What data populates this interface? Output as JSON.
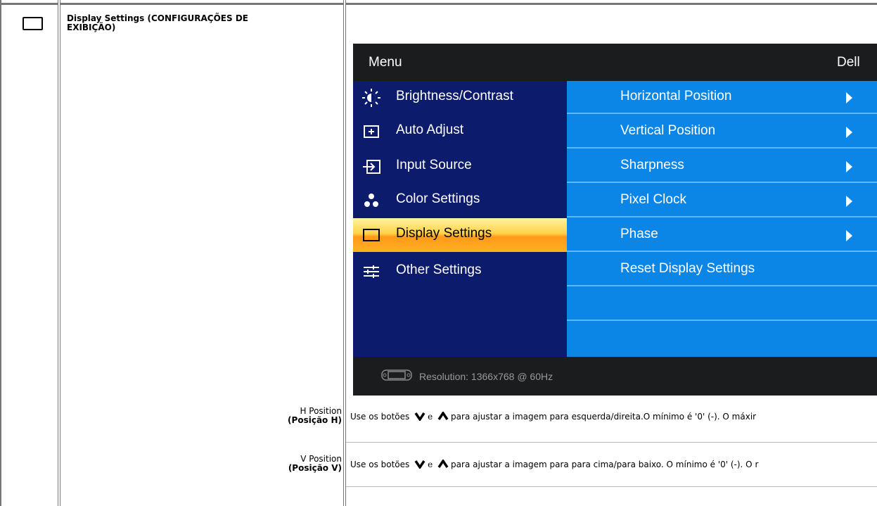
{
  "section": {
    "title": "Display Settings (CONFIGURAÇÕES DE EXIBIÇÃO)",
    "icon": "display-settings-icon"
  },
  "osd": {
    "menu_label": "Menu",
    "brand": "Dell",
    "left_items": [
      {
        "label": "Brightness/Contrast",
        "icon": "brightness-icon",
        "selected": false
      },
      {
        "label": "Auto Adjust",
        "icon": "auto-adjust-icon",
        "selected": false
      },
      {
        "label": "Input Source",
        "icon": "input-source-icon",
        "selected": false
      },
      {
        "label": "Color Settings",
        "icon": "color-settings-icon",
        "selected": false
      },
      {
        "label": "Display Settings",
        "icon": "display-settings-icon",
        "selected": true
      },
      {
        "label": "Other Settings",
        "icon": "other-settings-icon",
        "selected": false
      }
    ],
    "right_items": [
      {
        "label": "Horizontal Position",
        "has_arrow": true
      },
      {
        "label": "Vertical Position",
        "has_arrow": true
      },
      {
        "label": "Sharpness",
        "has_arrow": true
      },
      {
        "label": "Pixel Clock",
        "has_arrow": true
      },
      {
        "label": "Phase",
        "has_arrow": true
      },
      {
        "label": "Reset Display Settings",
        "has_arrow": false
      },
      {
        "label": "",
        "has_arrow": false
      },
      {
        "label": "",
        "has_arrow": false
      }
    ],
    "resolution": "Resolution: 1366x768 @ 60Hz",
    "colors": {
      "left_bg": "#0d1b6c",
      "right_bg": "#0b86e6",
      "selected": "#ffb020",
      "frame": "#1b1c1e"
    }
  },
  "rows": [
    {
      "label_line1": "H Position",
      "label_line2": "(Posição H)",
      "desc_before": "Use os botões",
      "conjunction": "e",
      "desc_after": "para ajustar a imagem para esquerda/direita.O mínimo é '0' (-). O máxir"
    },
    {
      "label_line1": "V Position",
      "label_line2": "(Posição V)",
      "desc_before": "Use os botões",
      "conjunction": "e",
      "desc_after": "para ajustar a imagem para para cima/para baixo. O mínimo é '0' (-). O r"
    }
  ]
}
